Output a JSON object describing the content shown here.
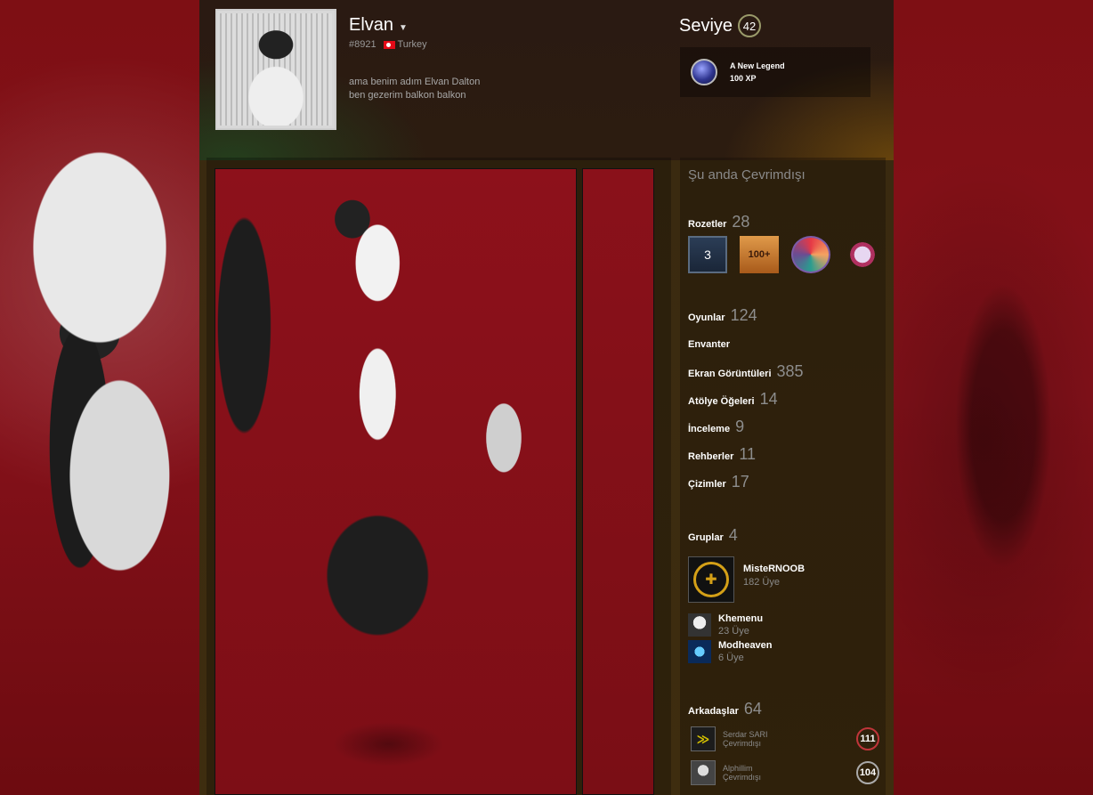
{
  "profile": {
    "name": "Elvan",
    "id": "#8921",
    "country": "Turkey",
    "summary_line1": "ama benim adım Elvan Dalton",
    "summary_line2": "ben gezerim balkon balkon"
  },
  "level": {
    "label": "Seviye",
    "value": "42"
  },
  "favorite_badge": {
    "name": "A New Legend",
    "xp": "100 XP"
  },
  "status": "Şu anda Çevrimdışı",
  "badges": {
    "label": "Rozetler",
    "count": "28",
    "items": [
      "3",
      "100+"
    ]
  },
  "counts": [
    {
      "label": "Oyunlar",
      "value": "124"
    },
    {
      "label": "Envanter",
      "value": ""
    },
    {
      "label": "Ekran Görüntüleri",
      "value": "385"
    },
    {
      "label": "Atölye Öğeleri",
      "value": "14"
    },
    {
      "label": "İnceleme",
      "value": "9"
    },
    {
      "label": "Rehberler",
      "value": "11"
    },
    {
      "label": "Çizimler",
      "value": "17"
    }
  ],
  "groups": {
    "label": "Gruplar",
    "count": "4",
    "primary": {
      "name": "MisteRNOOB",
      "members": "182 Üye"
    },
    "others": [
      {
        "name": "Khemenu",
        "members": "23 Üye"
      },
      {
        "name": "Modheaven",
        "members": "6 Üye"
      }
    ]
  },
  "friends": {
    "label": "Arkadaşlar",
    "count": "64",
    "items": [
      {
        "name": "Serdar SARI",
        "status": "Çevrimdışı",
        "level": "111"
      },
      {
        "name": "Alphillim",
        "status": "Çevrimdışı",
        "level": "104"
      }
    ]
  }
}
